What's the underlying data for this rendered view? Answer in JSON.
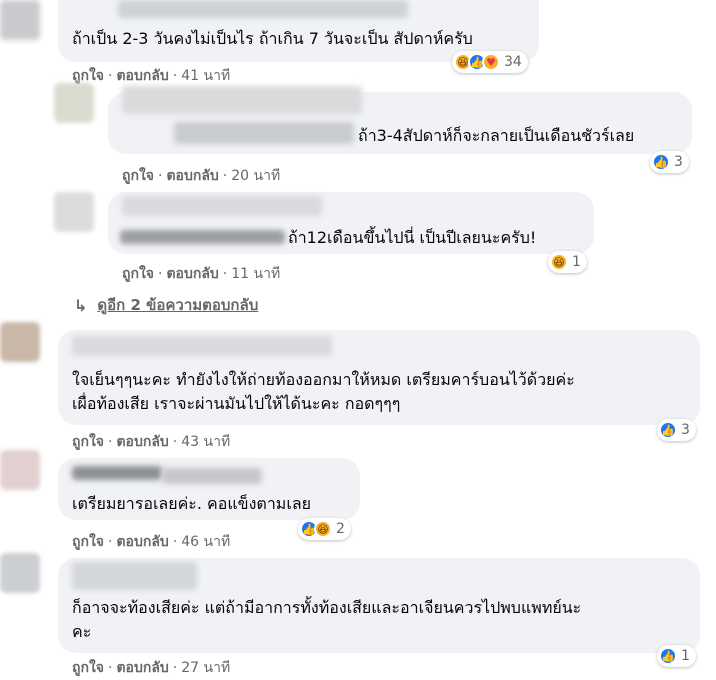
{
  "labels": {
    "like": "ถูกใจ",
    "reply": "ตอบกลับ"
  },
  "comments": [
    {
      "text": "ถ้าเป็น 2-3 วันคงไม่เป็นไร ถ้าเกิน 7 วันจะเป็น สัปดาห์ครับ",
      "time": "41 นาที",
      "reactions": [
        "haha-icon",
        "like-icon",
        "care-icon"
      ],
      "reaction_count": "34"
    },
    {
      "text": "ถ้า3-4สัปดาห์ก็จะกลายเป็นเดือนชัวร์เลย",
      "time": "20 นาที",
      "reactions": [
        "like-icon"
      ],
      "reaction_count": "3"
    },
    {
      "text": "ถ้า12เดือนขึ้นไปนี่ เป็นปีเลยนะครับ!",
      "time": "11 นาที",
      "reactions": [
        "haha-icon"
      ],
      "reaction_count": "1"
    },
    {
      "text_lines": [
        "ใจเย็นๆๆนะคะ ทำยังไงให้ถ่ายท้องออกมาให้หมด เตรียมคาร์บอนไว้ด้วยค่ะ",
        "เผื่อท้องเสีย เราจะผ่านมันไปให้ได้นะคะ กอดๆๆๆ"
      ],
      "time": "43 นาที",
      "reactions": [
        "like-icon"
      ],
      "reaction_count": "3"
    },
    {
      "text": "เตรียมยารอเลยค่ะ. คอแข็งตามเลย",
      "time": "46 นาที",
      "reactions": [
        "like-icon",
        "haha-icon"
      ],
      "reaction_count": "2"
    },
    {
      "text_lines": [
        "ก็อาจจะท้องเสียค่ะ แต่ถ้ามีอาการทั้งท้องเสียและอาเจียนควรไปพบแพทย์นะ",
        "คะ"
      ],
      "time": "27 นาที",
      "reactions": [
        "like-icon"
      ],
      "reaction_count": "1"
    }
  ],
  "view_more_replies": "ดูอีก 2 ข้อความตอบกลับ",
  "colors": {
    "bubble": "#f0f2f5",
    "secondary_text": "#65676b",
    "like_blue": "#1877f2",
    "haha_yellow": "#f7b125"
  }
}
